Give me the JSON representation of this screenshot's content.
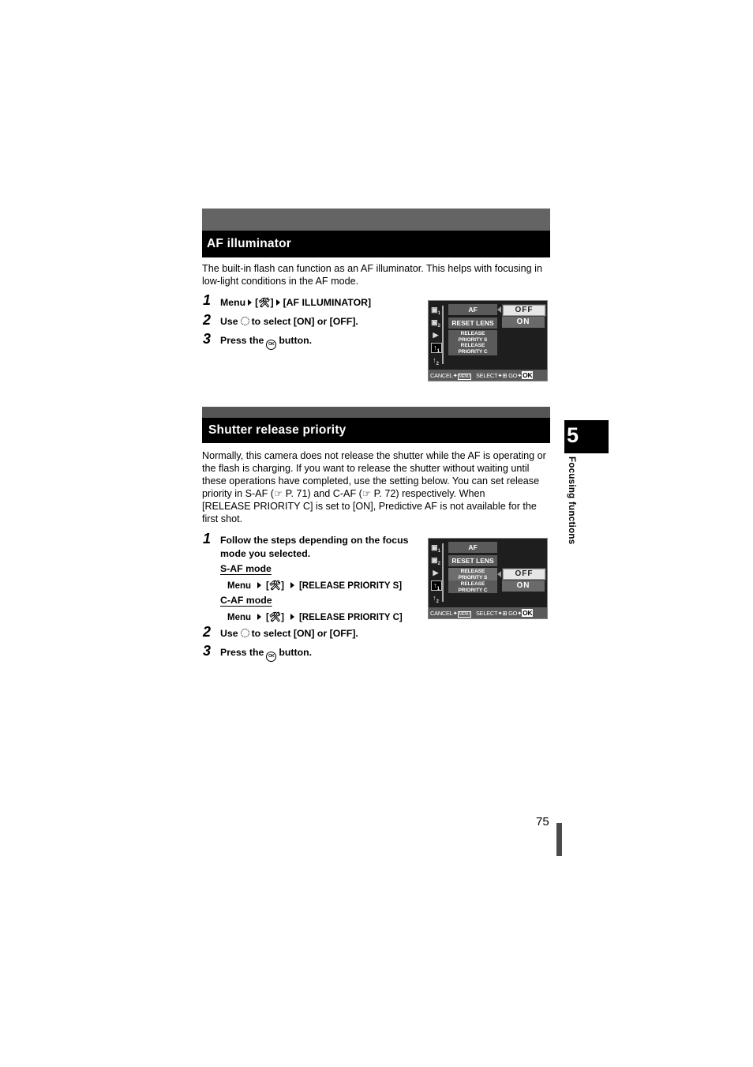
{
  "sections": [
    {
      "title": "AF illuminator",
      "intro": "The built-in flash can function as an AF illuminator. This helps with focusing in low-light conditions in the AF mode.",
      "intro_lines": [
        "The built-in flash can function as an AF illuminator. This helps with focusing in",
        "low-light conditions in the AF mode."
      ],
      "steps": [
        {
          "num": "1",
          "menu": "Menu",
          "tab": "[",
          "tab_icon": "wrench-1",
          "tab_close": "]",
          "target": "[AF ILLUMINATOR]"
        },
        {
          "num": "2",
          "pre": "Use",
          "icon": "dial-icon",
          "post": "to select [ON] or [OFF]."
        },
        {
          "num": "3",
          "pre": "Press the",
          "icon": "ok-button-icon",
          "post": "button."
        }
      ],
      "screen": {
        "menu_items": [
          "AF ILLUMINATOR",
          "RESET LENS",
          "RELEASE",
          "PRIORITY S",
          "RELEASE",
          "PRIORITY C"
        ],
        "options": [
          "OFF",
          "ON"
        ],
        "selected_option": "OFF",
        "active_item": "AF ILLUMINATOR",
        "footer": {
          "cancel": "CANCEL",
          "menu": "MENU",
          "select": "SELECT",
          "go": "GO",
          "ok": "OK"
        }
      }
    },
    {
      "title": "Shutter release priority",
      "intro_lines": [
        "Normally, this camera does not release the shutter while the AF is operating or",
        "the flash is charging. If you want to release the shutter without waiting until",
        "these operations have completed, use the setting below. You can set release",
        "priority in S-AF (",
        " P. 71) and C-AF (",
        " P. 72) respectively. When",
        "[RELEASE PRIORITY C] is set to [ON], Predictive AF is not available for the",
        "first shot."
      ],
      "steps": [
        {
          "num": "1",
          "text_line1": "Follow the steps depending on the focus",
          "text_line2": "mode you selected."
        },
        {
          "num": "2",
          "pre": "Use",
          "icon": "dial-icon",
          "post": "to select [ON] or [OFF]."
        },
        {
          "num": "3",
          "pre": "Press the",
          "icon": "ok-button-icon",
          "post": "button."
        }
      ],
      "modes": [
        {
          "label": "S-AF mode",
          "menu": "Menu",
          "tab": "[",
          "tab_close": "]",
          "target": "[RELEASE PRIORITY S]"
        },
        {
          "label": "C-AF mode",
          "menu": "Menu",
          "tab": "[",
          "tab_close": "]",
          "target": "[RELEASE PRIORITY C]"
        }
      ],
      "screen": {
        "menu_items": [
          "AF ILLUMINATOR",
          "RESET LENS",
          "RELEASE",
          "PRIORITY S",
          "RELEASE",
          "PRIORITY C"
        ],
        "options": [
          "OFF",
          "ON"
        ],
        "selected_option": "OFF",
        "active_item": "RELEASE PRIORITY S",
        "footer": {
          "cancel": "CANCEL",
          "menu": "MENU",
          "select": "SELECT",
          "go": "GO",
          "ok": "OK"
        }
      }
    }
  ],
  "side_tabs": {
    "camera1": "1",
    "camera2": "2",
    "wrench1": "1",
    "wrench2": "2"
  },
  "chapter": {
    "number": "5",
    "label": "Focusing functions"
  },
  "page_number": "75"
}
